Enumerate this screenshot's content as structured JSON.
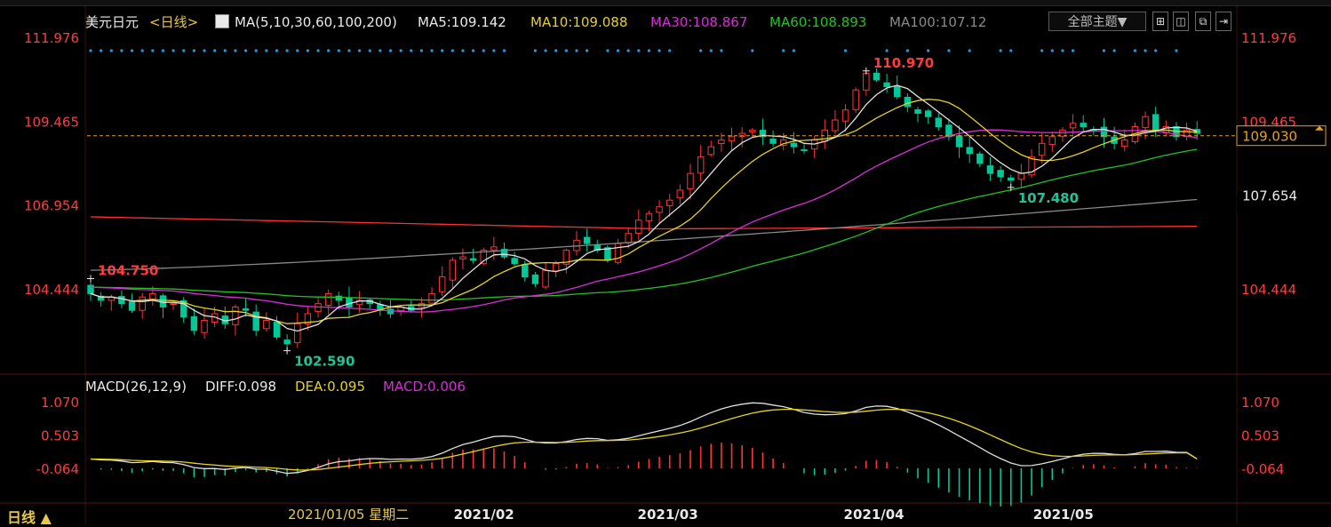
{
  "header": {
    "symbol": "美元日元",
    "period": "<日线>",
    "ma_spec": "MA(5,10,30,60,100,200)",
    "ma5": "MA5:109.142",
    "ma10": "MA10:109.088",
    "ma30": "MA30:108.867",
    "ma60": "MA60:108.893",
    "ma100": "MA100:107.12",
    "theme_button": "全部主题▼"
  },
  "colors": {
    "bg": "#000000",
    "up": "#ff3333",
    "down": "#00c896",
    "ma5": "#e0e0e0",
    "ma10": "#e6d21e",
    "ma30": "#d82ed8",
    "ma60": "#22c322",
    "ma100": "#888888",
    "ma200": "#ff3030",
    "axis_text": "#ff3b3b",
    "diff": "#e0e0e0",
    "dea": "#e6d21e",
    "macd_label": "#d82ed8"
  },
  "macd_header": {
    "spec": "MACD(26,12,9)",
    "diff": "DIFF:0.098",
    "dea": "DEA:0.095",
    "macd": "MACD:0.006"
  },
  "x_axis": {
    "cursor_label": "2021/01/05 星期二",
    "months": [
      "2021/02",
      "2021/03",
      "2021/04",
      "2021/05"
    ]
  },
  "bottom_label": "日线 ▲",
  "chart_data": [
    {
      "type": "candlestick",
      "title": "美元日元 日线",
      "y_ticks": [
        111.976,
        109.465,
        106.954,
        104.444
      ],
      "ylim": [
        101.3,
        112.4
      ],
      "current_price": 109.03,
      "right_tags": [
        109.03,
        107.654
      ],
      "annotations": [
        {
          "label": "110.970",
          "value": 110.97,
          "kind": "high"
        },
        {
          "label": "104.750",
          "value": 104.75,
          "kind": "high"
        },
        {
          "label": "102.590",
          "value": 102.59,
          "kind": "low"
        },
        {
          "label": "107.480",
          "value": 107.48,
          "kind": "low"
        }
      ],
      "closes": [
        104.3,
        104.1,
        104.2,
        104.0,
        103.8,
        104.2,
        104.3,
        103.9,
        104.0,
        103.6,
        103.2,
        103.5,
        103.7,
        103.4,
        103.9,
        103.8,
        103.2,
        103.5,
        103.0,
        102.8,
        103.4,
        103.7,
        104.0,
        104.3,
        104.1,
        103.9,
        104.1,
        104.0,
        103.8,
        103.7,
        103.9,
        103.8,
        104.0,
        104.3,
        104.8,
        105.3,
        105.4,
        105.3,
        105.6,
        105.7,
        105.4,
        105.2,
        104.8,
        104.6,
        105.0,
        105.2,
        105.6,
        105.9,
        105.8,
        105.6,
        105.3,
        105.8,
        106.1,
        106.5,
        106.7,
        106.9,
        107.1,
        107.4,
        107.9,
        108.4,
        108.7,
        108.9,
        109.0,
        109.1,
        109.2,
        109.0,
        108.8,
        108.9,
        108.7,
        108.6,
        108.9,
        109.2,
        109.5,
        109.8,
        110.4,
        110.9,
        110.7,
        110.5,
        110.2,
        109.9,
        109.7,
        109.6,
        109.3,
        109.0,
        108.7,
        108.5,
        108.2,
        107.9,
        107.8,
        107.7,
        107.9,
        108.4,
        108.8,
        109.0,
        109.2,
        109.4,
        109.3,
        109.2,
        109.0,
        108.8,
        108.9,
        109.3,
        109.6,
        109.2,
        109.3,
        109.0,
        109.2,
        109.1
      ],
      "ma": {
        "ma100": {
          "start": 105.0,
          "end": 107.12
        },
        "ma200": {
          "start": 106.6,
          "end": 105.9
        }
      }
    },
    {
      "type": "macd",
      "title": "MACD(26,12,9)",
      "y_ticks": [
        1.07,
        0.503,
        -0.064
      ],
      "ylim": [
        -0.45,
        1.3
      ],
      "diff_last": 0.098,
      "dea_last": 0.095,
      "macd_last": 0.006
    }
  ]
}
